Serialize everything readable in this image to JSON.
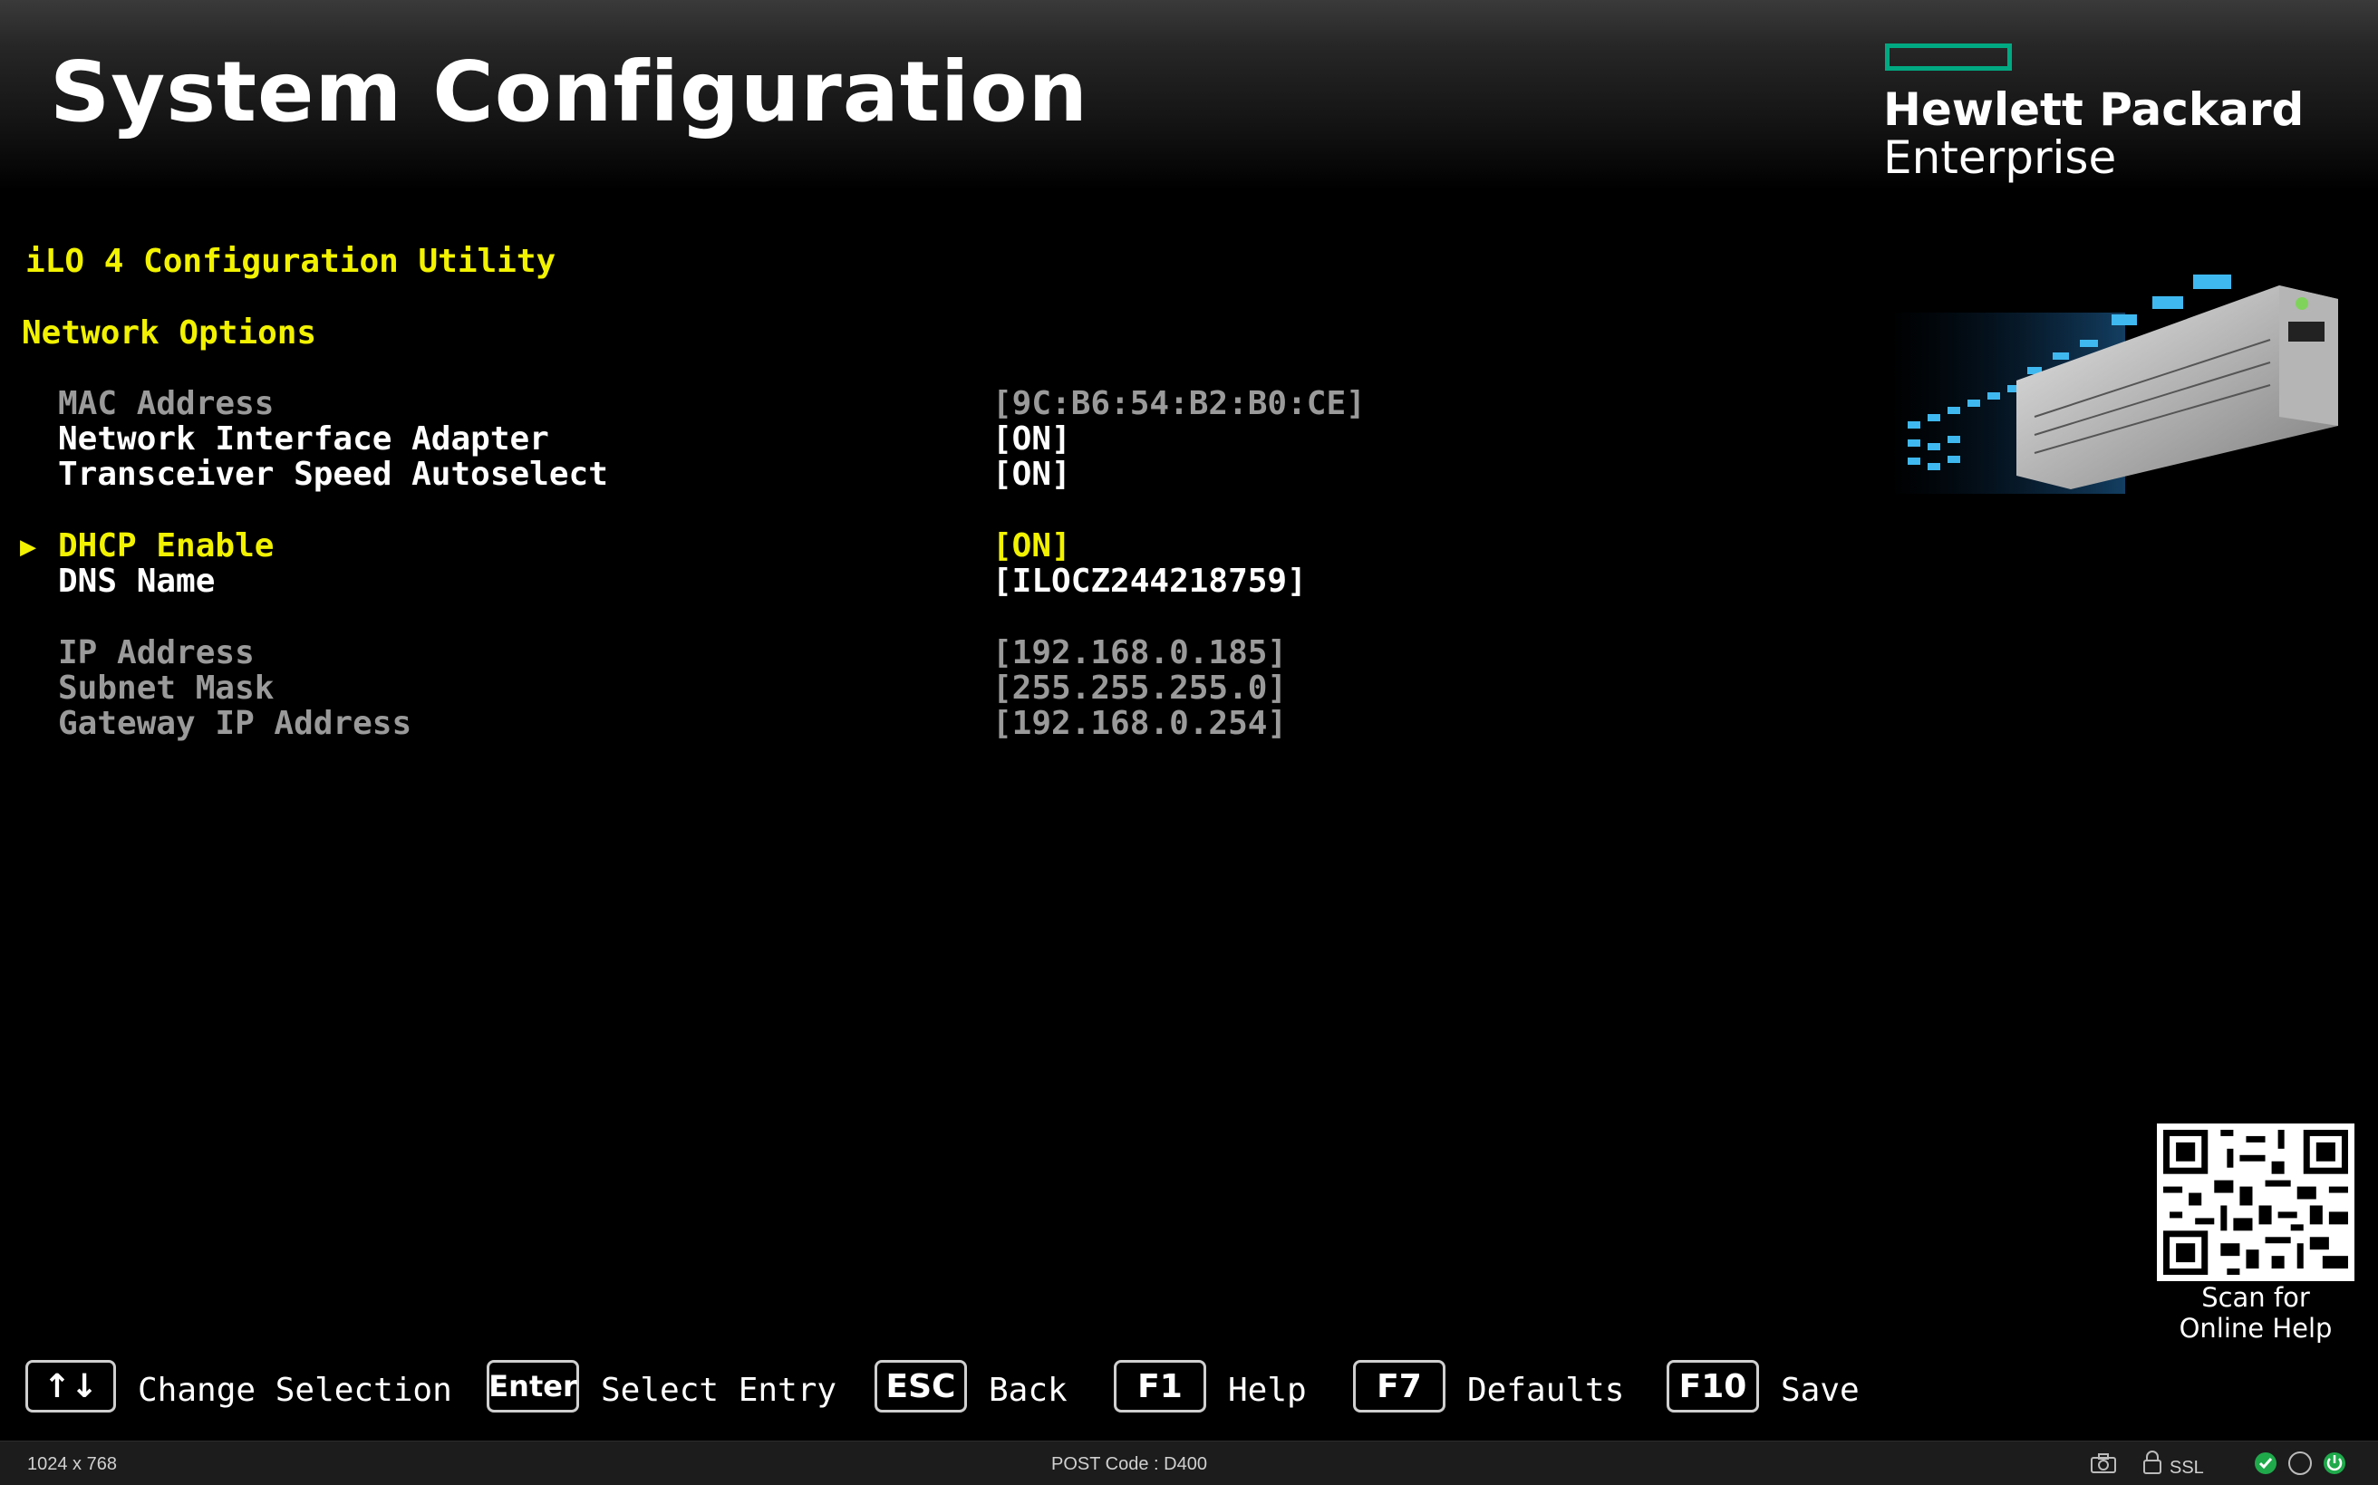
{
  "header": {
    "title": "System Configuration",
    "logo_line1": "Hewlett Packard",
    "logo_line2": "Enterprise"
  },
  "utility_title": "iLO 4 Configuration Utility",
  "section_title": "Network Options",
  "settings": [
    {
      "label": "MAC Address",
      "value": "[9C:B6:54:B2:B0:CE]",
      "state": "disabled"
    },
    {
      "label": "Network Interface Adapter",
      "value": "[ON]",
      "state": "normal"
    },
    {
      "label": "Transceiver Speed Autoselect",
      "value": "[ON]",
      "state": "normal"
    },
    {
      "label": "DHCP Enable",
      "value": "[ON]",
      "state": "selected"
    },
    {
      "label": "DNS Name",
      "value": "[ILOCZ244218759]",
      "state": "normal"
    },
    {
      "label": "IP Address",
      "value": "[192.168.0.185]",
      "state": "disabled"
    },
    {
      "label": "Subnet Mask",
      "value": "[255.255.255.0]",
      "state": "disabled"
    },
    {
      "label": "Gateway IP Address",
      "value": "[192.168.0.254]",
      "state": "disabled"
    }
  ],
  "footer_keys": [
    {
      "key": "↑↓",
      "label": "Change Selection"
    },
    {
      "key": "Enter",
      "label": "Select Entry"
    },
    {
      "key": "ESC",
      "label": "Back"
    },
    {
      "key": "F1",
      "label": "Help"
    },
    {
      "key": "F7",
      "label": "Defaults"
    },
    {
      "key": "F10",
      "label": "Save"
    }
  ],
  "qr_caption": {
    "line1": "Scan for",
    "line2": "Online Help"
  },
  "status_bar": {
    "resolution": "1024 x 768",
    "post_code": "POST Code  :  D400",
    "ssl": "SSL"
  },
  "colors": {
    "accent_green": "#01a982",
    "highlight_yellow": "#f2f200"
  },
  "icons": [
    "camera-icon",
    "lock-icon",
    "check-circle-icon",
    "circle-icon",
    "power-icon"
  ]
}
